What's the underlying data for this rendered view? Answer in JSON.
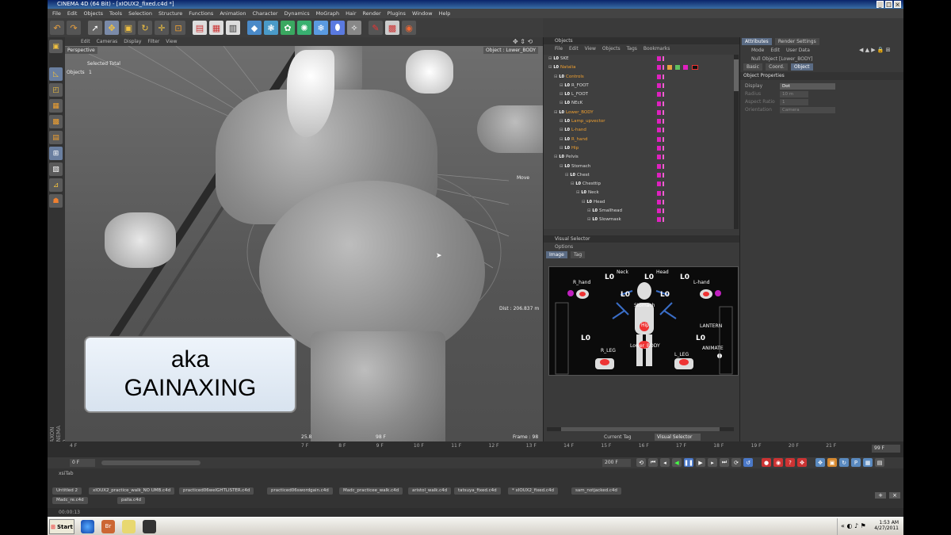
{
  "window": {
    "title": "CINEMA 4D (64 Bit) - [xIOUX2_fixed.c4d *]",
    "controls": [
      "_",
      "□",
      "×"
    ]
  },
  "menu": [
    "File",
    "Edit",
    "Objects",
    "Tools",
    "Selection",
    "Structure",
    "Functions",
    "Animation",
    "Character",
    "Dynamics",
    "MoGraph",
    "Hair",
    "Render",
    "Plugins",
    "Window",
    "Help"
  ],
  "viewport": {
    "menu": [
      "Edit",
      "Cameras",
      "Display",
      "Filter",
      "View"
    ],
    "label": "Perspective",
    "selected_total": "Selected Total",
    "objects_label": "Objects",
    "objects_count": "1",
    "object_info": "Object : Lower_BODY",
    "move_label": "Move",
    "dist": "Dist : 206.837 m",
    "frame": "Frame : 98",
    "readout_left": "25.8",
    "readout_mid": "98 F"
  },
  "caption": {
    "line1": "aka",
    "line2": "GAINAXING"
  },
  "object_manager": {
    "title": "Objects",
    "menu": [
      "File",
      "Edit",
      "View",
      "Objects",
      "Tags",
      "Bookmarks"
    ],
    "items": [
      {
        "label": "SKE",
        "indent": 0,
        "hi": false
      },
      {
        "label": "Natalia",
        "indent": 0,
        "hi": true
      },
      {
        "label": "Controls",
        "indent": 1,
        "hi": true
      },
      {
        "label": "R_FOOT",
        "indent": 2,
        "hi": false
      },
      {
        "label": "L_FOOT",
        "indent": 2,
        "hi": false
      },
      {
        "label": "NEcK",
        "indent": 2,
        "hi": false
      },
      {
        "label": "Lower_BODY",
        "indent": 1,
        "hi": true
      },
      {
        "label": "Lamp_upvector",
        "indent": 2,
        "hi": true
      },
      {
        "label": "L-hand",
        "indent": 2,
        "hi": true
      },
      {
        "label": "R_hand",
        "indent": 2,
        "hi": true
      },
      {
        "label": "Hip",
        "indent": 2,
        "hi": true
      },
      {
        "label": "Pelvis",
        "indent": 1,
        "hi": false
      },
      {
        "label": "Stomach",
        "indent": 2,
        "hi": false
      },
      {
        "label": "Chest",
        "indent": 3,
        "hi": false
      },
      {
        "label": "Chesttip",
        "indent": 4,
        "hi": false
      },
      {
        "label": "Neck",
        "indent": 5,
        "hi": false
      },
      {
        "label": "Head",
        "indent": 6,
        "hi": false
      },
      {
        "label": "Smallhead",
        "indent": 7,
        "hi": false
      },
      {
        "label": "Slowmask",
        "indent": 7,
        "hi": false
      }
    ]
  },
  "attributes": {
    "tabs": [
      "Attributes",
      "Render Settings"
    ],
    "menu": [
      "Mode",
      "Edit",
      "User Data"
    ],
    "object_title": "Null Object [Lower_BODY]",
    "subtabs": [
      "Basic",
      "Coord.",
      "Object"
    ],
    "section": "Object Properties",
    "rows": [
      {
        "label": "Display",
        "value": "Dot"
      },
      {
        "label": "Radius",
        "value": "10 m"
      },
      {
        "label": "Aspect Ratio",
        "value": "1"
      },
      {
        "label": "Orientation",
        "value": "Camera"
      }
    ]
  },
  "visual_selector": {
    "title": "Visual Selector",
    "options": "Options",
    "tabs": [
      "Image",
      "Tag"
    ],
    "labels": {
      "r_hand": "R_hand",
      "neck": "Neck",
      "head": "Head",
      "l_hand": "L-hand",
      "stomach": "Stomach",
      "hip": "Hip",
      "lantern": "LANTERN",
      "lower_body": "Lower_BODY",
      "r_leg": "R_LEG",
      "l_leg": "L_LEG",
      "animate": "ANIMATE"
    },
    "current_tag_label": "Current Tag",
    "current_tag_value": "Visual Selector"
  },
  "timeline": {
    "ticks": [
      "4 F",
      "7 F",
      "8 F",
      "9 F",
      "10 F",
      "11 F",
      "12 F",
      "13 F",
      "14 F",
      "15 F",
      "16 F",
      "17 F",
      "18 F",
      "19 F",
      "20 F",
      "21 F"
    ],
    "end_field": "99 F",
    "start_field": "0 F",
    "max_field": "200 F"
  },
  "file_tabs": {
    "top_label": "xsiTab",
    "row1": [
      "Untitled 2",
      "xIOUX2_practice_walk_NO UMB.c4d",
      "practiced06welGHTLISTER.c4d",
      "practiced06swordgain.c4d",
      "Madc_practicee_walk.c4d",
      "aristol_walk.c4d",
      "tatsuya_fixed.c4d",
      "* xIOUX2_fixed.c4d",
      "sam_notjacked.c4d"
    ],
    "row2": [
      "Madc_re.c4d",
      "palla.c4d"
    ]
  },
  "status": "00:00:13",
  "brand": "MAXON CINEMA 4D",
  "taskbar": {
    "start": "Start",
    "time": "1:53 AM",
    "date": "4/27/2011"
  },
  "colors": {
    "accent_orange": "#f0a030",
    "tag_magenta": "#e020c0",
    "active_tab_blue": "#5a6b84"
  }
}
